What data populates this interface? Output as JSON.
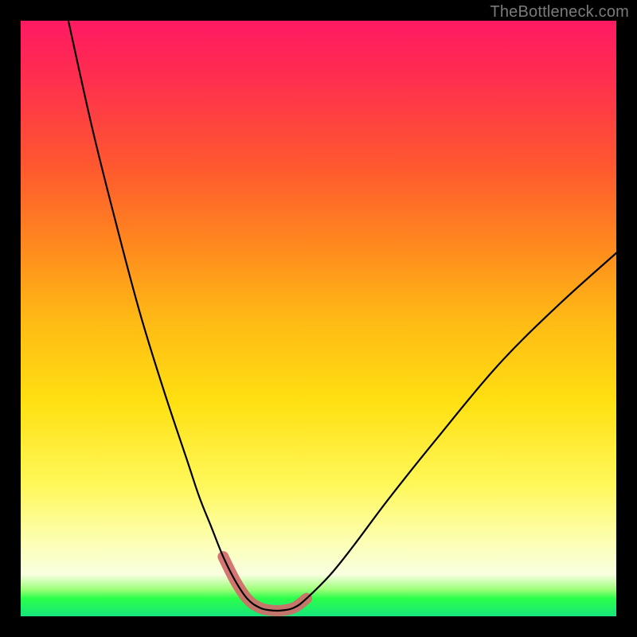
{
  "watermark": {
    "text": "TheBottleneck.com"
  },
  "chart_data": {
    "type": "line",
    "title": "",
    "xlabel": "",
    "ylabel": "",
    "xlim": [
      0,
      100
    ],
    "ylim": [
      0,
      100
    ],
    "grid": false,
    "legend": false,
    "annotations": [],
    "background_gradient": {
      "direction": "vertical",
      "stops": [
        {
          "pos": 0.0,
          "color": "#ff1a63"
        },
        {
          "pos": 0.1,
          "color": "#ff2f4e"
        },
        {
          "pos": 0.25,
          "color": "#ff5a2e"
        },
        {
          "pos": 0.38,
          "color": "#ff8a1e"
        },
        {
          "pos": 0.5,
          "color": "#ffb915"
        },
        {
          "pos": 0.64,
          "color": "#ffe012"
        },
        {
          "pos": 0.78,
          "color": "#fff85a"
        },
        {
          "pos": 0.88,
          "color": "#fcffb8"
        },
        {
          "pos": 0.93,
          "color": "#f7ffe0"
        },
        {
          "pos": 0.955,
          "color": "#9dff7a"
        },
        {
          "pos": 0.97,
          "color": "#2bff4a"
        },
        {
          "pos": 1.0,
          "color": "#16e67c"
        }
      ]
    },
    "series": [
      {
        "name": "bottleneck-curve",
        "color": "#000000",
        "x": [
          8,
          12,
          16,
          20,
          24,
          28,
          30,
          32,
          34,
          36,
          38,
          40,
          42,
          44,
          46,
          48,
          52,
          56,
          62,
          70,
          80,
          90,
          100
        ],
        "y": [
          100,
          82,
          66,
          51,
          38,
          26,
          20,
          15,
          10,
          6,
          3,
          1.5,
          1,
          1,
          1.5,
          3,
          7,
          12,
          20,
          30,
          42,
          52,
          61
        ]
      }
    ],
    "highlight": {
      "name": "optimal-range-marker",
      "color": "#d26a6a",
      "x": [
        34,
        36,
        38,
        40,
        42,
        44,
        46,
        48
      ],
      "y": [
        10,
        6,
        3,
        1.5,
        1,
        1,
        1.5,
        3
      ]
    }
  }
}
